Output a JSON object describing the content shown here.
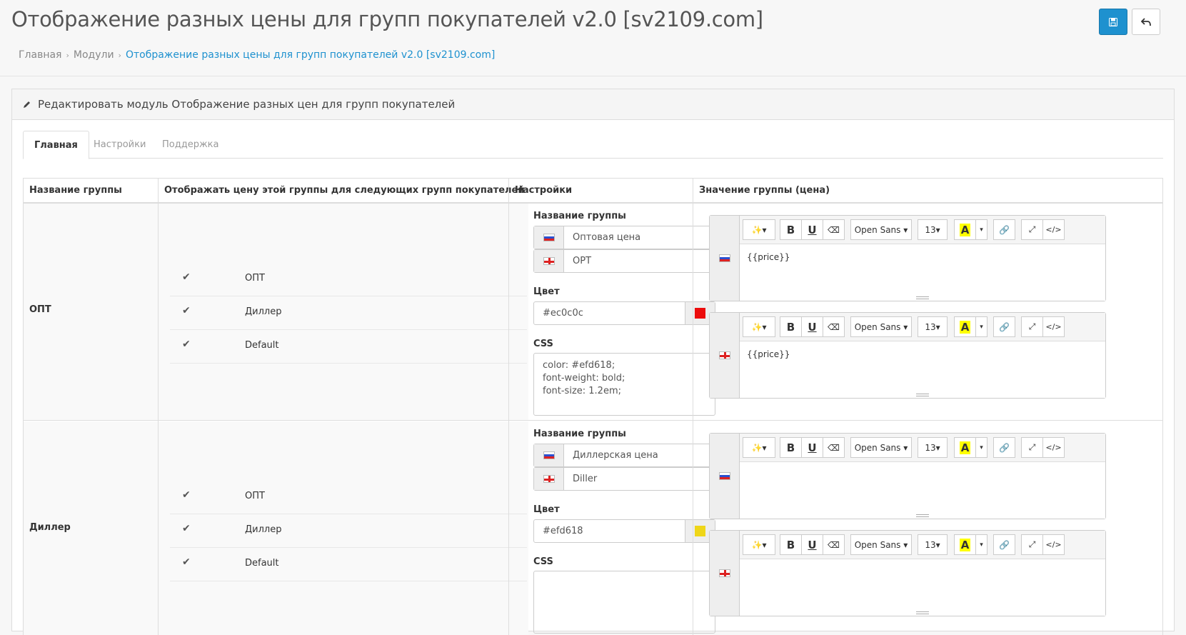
{
  "header": {
    "title": "Отображение разных цены для групп покупателей v2.0 [sv2109.com]",
    "save_icon": "save-icon",
    "back_icon": "reply-icon"
  },
  "breadcrumb": {
    "items": [
      "Главная",
      "Модули"
    ],
    "active": "Отображение разных цены для групп покупателей v2.0 [sv2109.com]"
  },
  "panel": {
    "heading": "Редактировать модуль Отображение разных цен для групп покупателей"
  },
  "tabs": [
    "Главная",
    "Настройки",
    "Поддержка"
  ],
  "table": {
    "headers": [
      "Название группы",
      "Отображать цену этой группы для следующих групп покупателей",
      "Настройки",
      "Значение группы (цена)"
    ],
    "name_label": "Название группы",
    "color_label": "Цвет",
    "css_label": "CSS",
    "rows": [
      {
        "group": "ОПТ",
        "checks": [
          "ОПТ",
          "Диллер",
          "Default"
        ],
        "name_ru": "Оптовая цена",
        "name_en": "OPT",
        "color": "#ec0c0c",
        "css": [
          "color: #efd618;",
          "font-weight: bold;",
          "font-size: 1.2em;"
        ],
        "price_ru": "{{price}}",
        "price_en": "{{price}}"
      },
      {
        "group": "Диллер",
        "checks": [
          "ОПТ",
          "Диллер",
          "Default"
        ],
        "name_ru": "Диллерская цена",
        "name_en": "Diller",
        "color": "#efd618",
        "css": [],
        "price_ru": "",
        "price_en": ""
      }
    ]
  },
  "editor": {
    "font": "Open Sans",
    "size": "13",
    "bold": "B",
    "underline": "U",
    "highlight": "A",
    "code": "</>"
  },
  "colors": {
    "primary": "#1e91cf",
    "link": "#1e91cf",
    "highlight": "#ffff00"
  }
}
